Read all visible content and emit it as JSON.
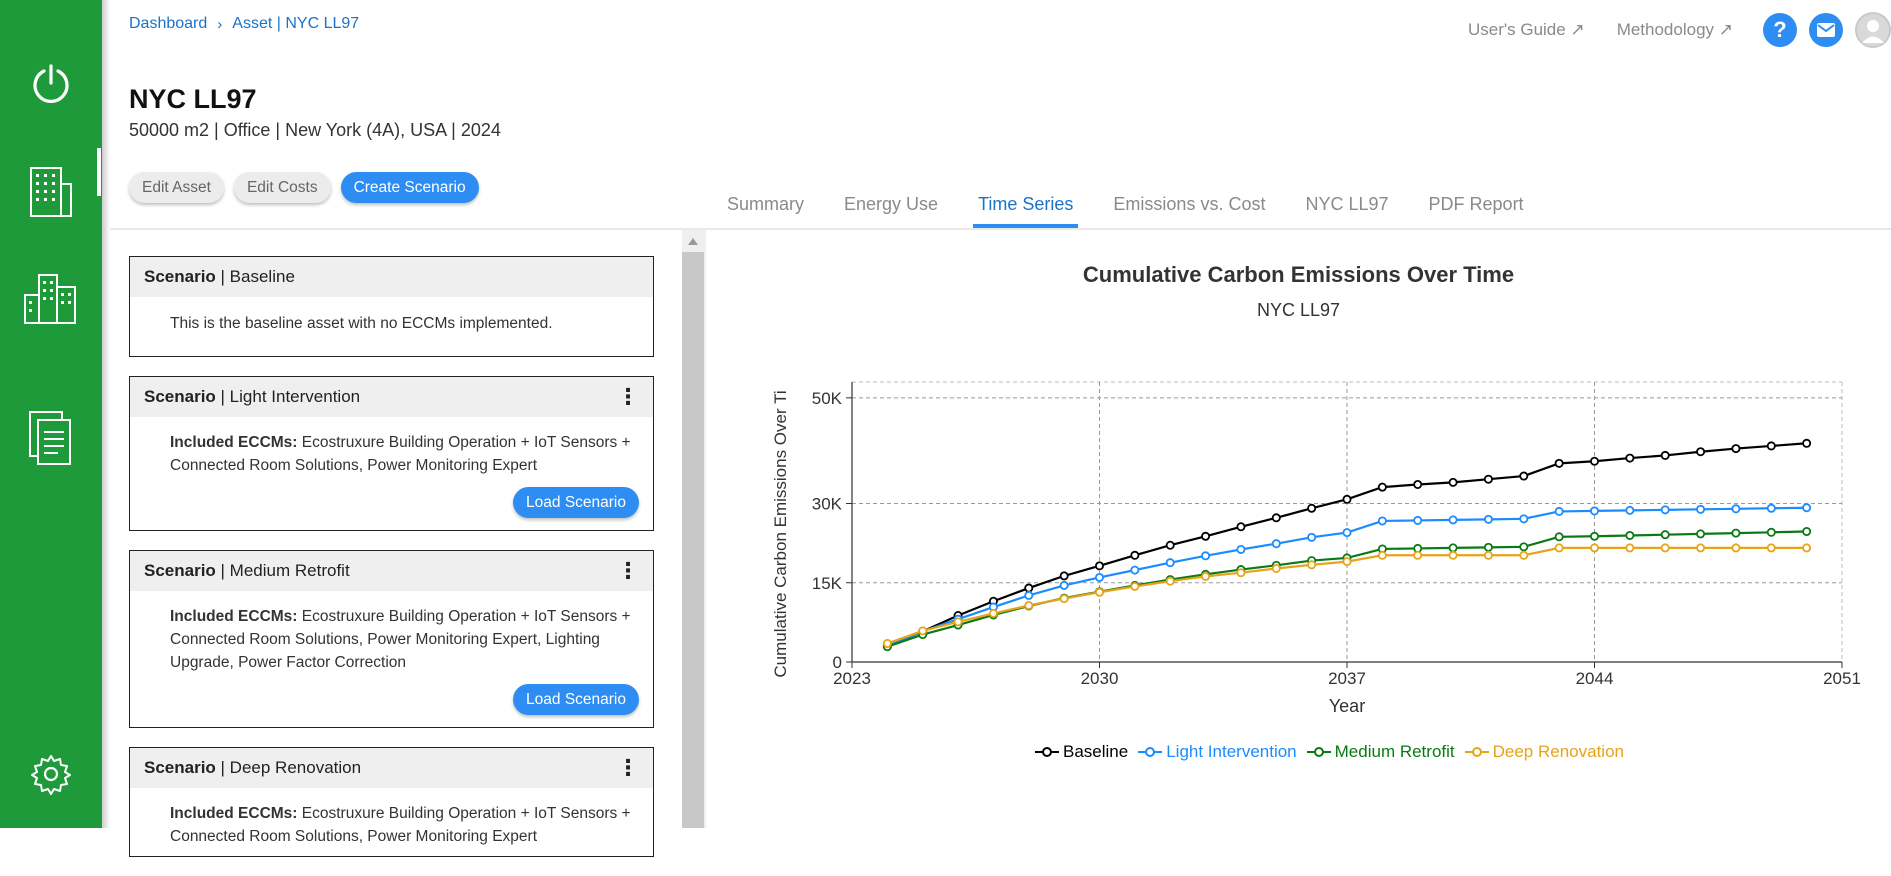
{
  "breadcrumb": {
    "home": "Dashboard",
    "sep": "›",
    "current": "Asset | NYC LL97"
  },
  "top_links": {
    "guide": "User's Guide ↗",
    "method": "Methodology ↗",
    "help": "?"
  },
  "asset": {
    "title": "NYC LL97",
    "subtitle": "50000 m2 | Office | New York (4A), USA | 2024"
  },
  "actions": {
    "edit_asset": "Edit Asset",
    "edit_costs": "Edit Costs",
    "create": "Create Scenario"
  },
  "tabs": [
    "Summary",
    "Energy Use",
    "Time Series",
    "Emissions vs. Cost",
    "NYC LL97",
    "PDF Report"
  ],
  "scenarios": [
    {
      "prefix": "Scenario",
      "name": "| Baseline",
      "desc": "This is the baseline asset with no ECCMs implemented."
    },
    {
      "prefix": "Scenario",
      "name": "| Light Intervention",
      "eccm_label": "Included ECCMs:",
      "eccms": "Ecostruxure Building Operation + IoT Sensors + Connected Room Solutions, Power Monitoring Expert",
      "load": "Load Scenario"
    },
    {
      "prefix": "Scenario",
      "name": "| Medium Retrofit",
      "eccm_label": "Included ECCMs:",
      "eccms": "Ecostruxure Building Operation + IoT Sensors + Connected Room Solutions, Power Monitoring Expert, Lighting Upgrade, Power Factor Correction",
      "load": "Load Scenario"
    },
    {
      "prefix": "Scenario",
      "name": "| Deep Renovation",
      "eccm_label": "Included ECCMs:",
      "eccms": "Ecostruxure Building Operation + IoT Sensors + Connected Room Solutions, Power Monitoring Expert"
    }
  ],
  "chart_data": {
    "type": "line",
    "title": "Cumulative Carbon Emissions Over Time",
    "subtitle": "NYC LL97",
    "xlabel": "Year",
    "ylabel": "Cumulative Carbon Emissions Over Ti",
    "xlim": [
      2023,
      2051
    ],
    "ylim": [
      0,
      53000
    ],
    "xticks": [
      2023,
      2030,
      2037,
      2044,
      2051
    ],
    "yticks": [
      0,
      15000,
      30000,
      50000
    ],
    "ytick_labels": [
      "0",
      "15K",
      "30K",
      "50K"
    ],
    "grid": true,
    "legend_position": "bottom",
    "x": [
      2024,
      2025,
      2026,
      2027,
      2028,
      2029,
      2030,
      2031,
      2032,
      2033,
      2034,
      2035,
      2036,
      2037,
      2038,
      2039,
      2040,
      2041,
      2042,
      2043,
      2044,
      2045,
      2046,
      2047,
      2048,
      2049,
      2050
    ],
    "series": [
      {
        "name": "Baseline",
        "color": "#000000",
        "values": [
          3000,
          5800,
          8800,
          11500,
          14000,
          16300,
          18200,
          20200,
          22100,
          23800,
          25600,
          27300,
          29100,
          30800,
          33100,
          33600,
          34000,
          34600,
          35200,
          37600,
          38000,
          38600,
          39100,
          39800,
          40400,
          40900,
          41400
        ]
      },
      {
        "name": "Light Intervention",
        "color": "#1a8cff",
        "values": [
          3100,
          5800,
          8100,
          10400,
          12600,
          14500,
          16000,
          17400,
          18800,
          20100,
          21300,
          22400,
          23600,
          24500,
          26700,
          26800,
          26900,
          27000,
          27100,
          28500,
          28600,
          28700,
          28800,
          28900,
          29000,
          29100,
          29200
        ]
      },
      {
        "name": "Medium Retrofit",
        "color": "#0a7a14",
        "values": [
          2900,
          5200,
          7000,
          8900,
          10600,
          12100,
          13300,
          14500,
          15600,
          16600,
          17500,
          18300,
          19200,
          19700,
          21400,
          21500,
          21600,
          21700,
          21800,
          23700,
          23800,
          23950,
          24100,
          24250,
          24400,
          24550,
          24700
        ]
      },
      {
        "name": "Deep Renovation",
        "color": "#e8a317",
        "values": [
          3500,
          5900,
          7600,
          9200,
          10700,
          12000,
          13200,
          14300,
          15300,
          16200,
          16900,
          17700,
          18400,
          19000,
          20200,
          20200,
          20200,
          20200,
          20200,
          21600,
          21600,
          21600,
          21600,
          21600,
          21600,
          21600,
          21600
        ]
      }
    ]
  }
}
